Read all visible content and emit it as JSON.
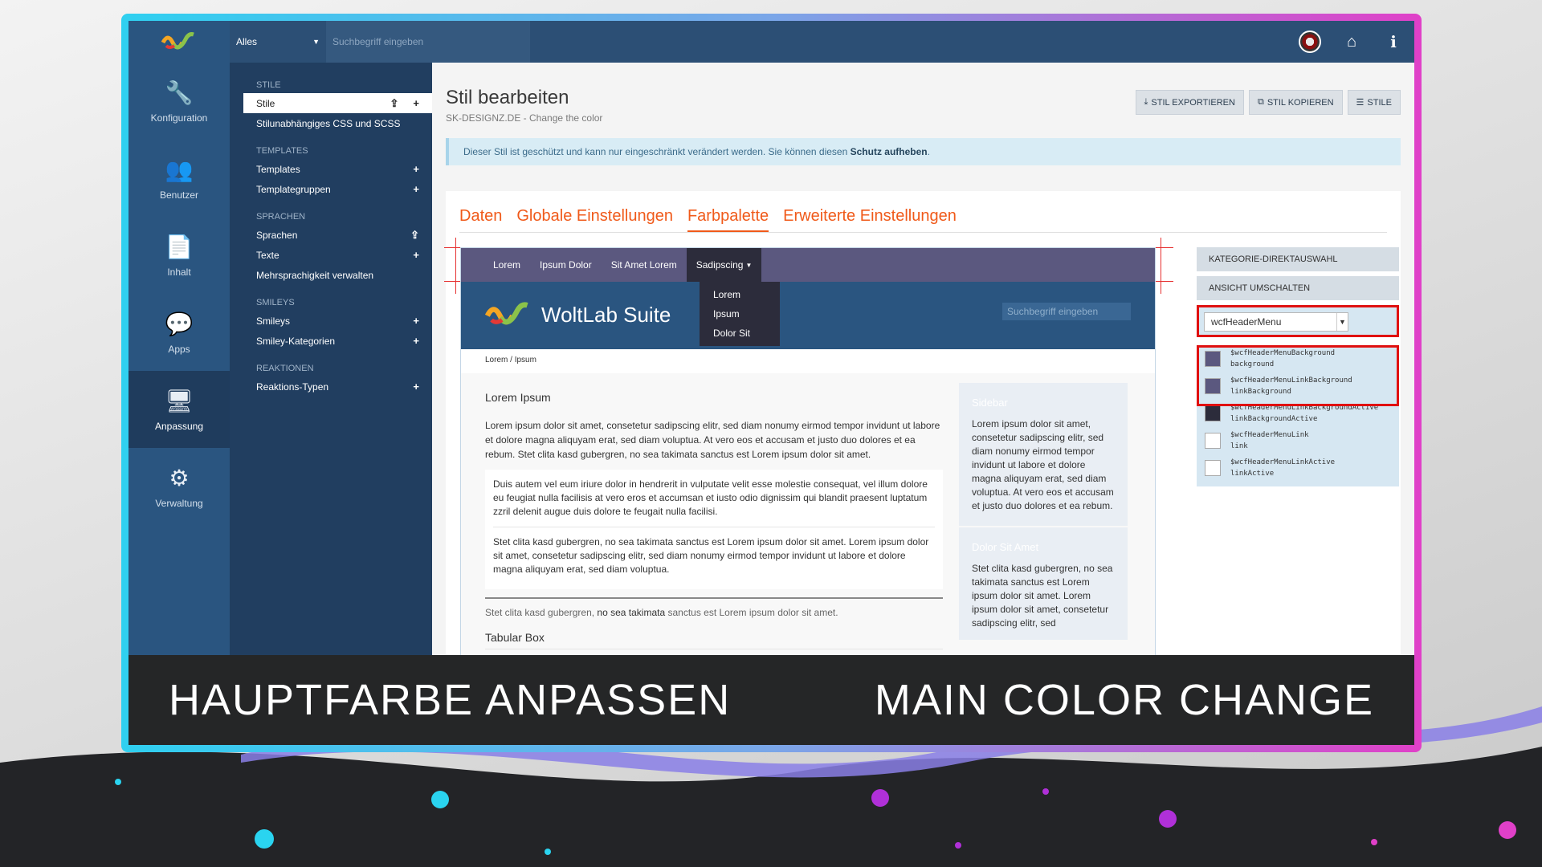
{
  "topbar": {
    "search_scope": "Alles",
    "search_placeholder": "Suchbegriff eingeben"
  },
  "main_nav": [
    {
      "label": "Konfiguration",
      "icon": "wrench-icon",
      "glyph": "🔧"
    },
    {
      "label": "Benutzer",
      "icon": "users-icon",
      "glyph": "👥"
    },
    {
      "label": "Inhalt",
      "icon": "file-icon",
      "glyph": "📄"
    },
    {
      "label": "Apps",
      "icon": "chat-icon",
      "glyph": "💬"
    },
    {
      "label": "Anpassung",
      "icon": "monitor-icon",
      "glyph": "🖥"
    },
    {
      "label": "Verwaltung",
      "icon": "gear-icon",
      "glyph": "⚙"
    }
  ],
  "sub_nav": {
    "stile": {
      "title": "STILE",
      "items": [
        "Stile",
        "Stilunabhängiges CSS und SCSS"
      ]
    },
    "templates": {
      "title": "TEMPLATES",
      "items": [
        "Templates",
        "Templategruppen"
      ]
    },
    "sprachen": {
      "title": "SPRACHEN",
      "items": [
        "Sprachen",
        "Texte",
        "Mehrsprachigkeit verwalten"
      ]
    },
    "smileys": {
      "title": "SMILEYS",
      "items": [
        "Smileys",
        "Smiley-Kategorien"
      ]
    },
    "reaktionen": {
      "title": "REAKTIONEN",
      "items": [
        "Reaktions-Typen"
      ]
    }
  },
  "page": {
    "title": "Stil bearbeiten",
    "subtitle": "SK-DESIGNZ.DE - Change the color",
    "btn_export": "STIL EXPORTIEREN",
    "btn_copy": "STIL KOPIEREN",
    "btn_styles": "STILE",
    "notice_text": "Dieser Stil ist geschützt und kann nur eingeschränkt verändert werden. Sie können diesen",
    "notice_link": "Schutz aufheben",
    "tabs": [
      "Daten",
      "Globale Einstellungen",
      "Farbpalette",
      "Erweiterte Einstellungen"
    ]
  },
  "preview": {
    "menu": [
      "Lorem",
      "Ipsum Dolor",
      "Sit Amet Lorem",
      "Sadipscing"
    ],
    "dropdown": [
      "Lorem",
      "Ipsum",
      "Dolor Sit"
    ],
    "logo_text": "WoltLab Suite",
    "search_placeholder": "Suchbegriff eingeben",
    "breadcrumb_1": "Lorem",
    "breadcrumb_2": "Ipsum",
    "heading": "Lorem Ipsum",
    "para": "Lorem ipsum dolor sit amet, consetetur sadipscing elitr, sed diam nonumy eirmod tempor invidunt ut labore et dolore magna aliquyam erat, sed diam voluptua. At vero eos et accusam et justo duo dolores et ea rebum. Stet clita kasd gubergren, no sea takimata sanctus est Lorem ipsum dolor sit amet.",
    "box_p1": "Duis autem vel eum iriure dolor in hendrerit in vulputate velit esse molestie consequat, vel illum dolore eu feugiat nulla facilisis at vero eros et accumsan et iusto odio dignissim qui blandit praesent luptatum zzril delenit augue duis dolore te feugait nulla facilisi.",
    "box_p2": "Stet clita kasd gubergren, no sea takimata sanctus est Lorem ipsum dolor sit amet. Lorem ipsum dolor sit amet, consetetur sadipscing elitr, sed diam nonumy eirmod tempor invidunt ut labore et dolore magna aliquyam erat, sed diam voluptua.",
    "note_a": "Stet clita kasd gubergren,",
    "note_b": " no sea takimata",
    "note_c": " sanctus est Lorem ipsum dolor sit amet.",
    "heading2": "Tabular Box",
    "aside1_title": "Sidebar",
    "aside1_text": "Lorem ipsum dolor sit amet, consetetur sadipscing elitr, sed diam nonumy eirmod tempor invidunt ut labore et dolore magna aliquyam erat, sed diam voluptua. At vero eos et accusam et justo duo dolores et ea rebum.",
    "aside2_title": "Dolor Sit Amet",
    "aside2_text": "Stet clita kasd gubergren, no sea takimata sanctus est Lorem ipsum dolor sit amet. Lorem ipsum dolor sit amet, consetetur sadipscing elitr, sed"
  },
  "palette": {
    "btn_category": "KATEGORIE-DIREKTAUSWAHL",
    "btn_view": "ANSICHT UMSCHALTEN",
    "selected": "wcfHeaderMenu",
    "vars": [
      {
        "name": "$wcfHeaderMenuBackground",
        "short": "background",
        "color": "#5b587f"
      },
      {
        "name": "$wcfHeaderMenuLinkBackground",
        "short": "linkBackground",
        "color": "#5b587f"
      },
      {
        "name": "$wcfHeaderMenuLinkBackgroundActive",
        "short": "linkBackgroundActive",
        "color": "#2c2c3b"
      },
      {
        "name": "$wcfHeaderMenuLink",
        "short": "link",
        "color": "#ffffff"
      },
      {
        "name": "$wcfHeaderMenuLinkActive",
        "short": "linkActive",
        "color": "#ffffff"
      }
    ]
  },
  "banner": {
    "left": "HAUPTFARBE ANPASSEN",
    "right": "MAIN COLOR CHANGE"
  }
}
